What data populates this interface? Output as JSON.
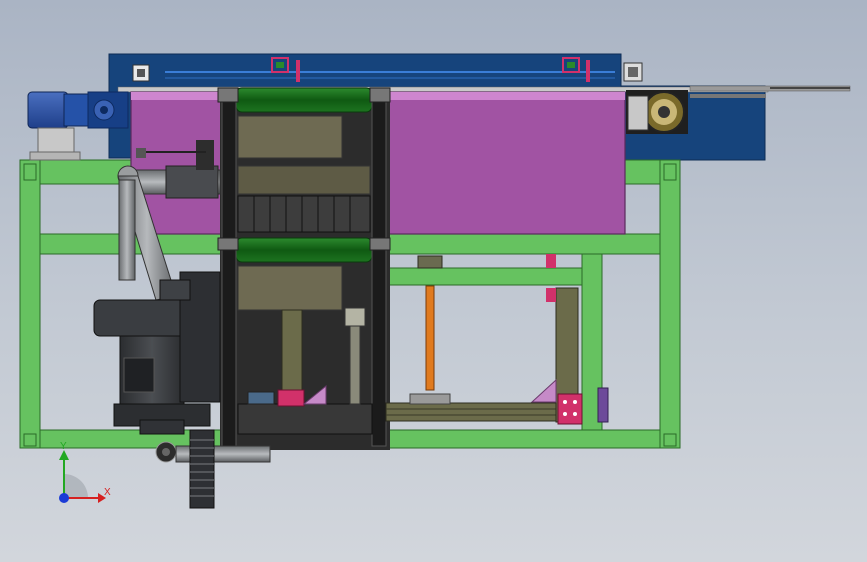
{
  "triad": {
    "y_label": "Y",
    "x_label": "X"
  },
  "colors": {
    "background_top": "#aab4c4",
    "background_bottom": "#d2d6dc",
    "frame_green": "#66c260",
    "tank_magenta": "#a153a3",
    "panel_navy": "#16447c",
    "roller_green": "#1c6b1e",
    "pump_dark": "#3a3d41",
    "pipe_gray": "#8d9093",
    "orange_rod": "#e07a1e",
    "accent_pink": "#d1316a",
    "axis_x": "#d62020",
    "axis_y": "#22a822",
    "axis_z": "#1b3bd6"
  }
}
